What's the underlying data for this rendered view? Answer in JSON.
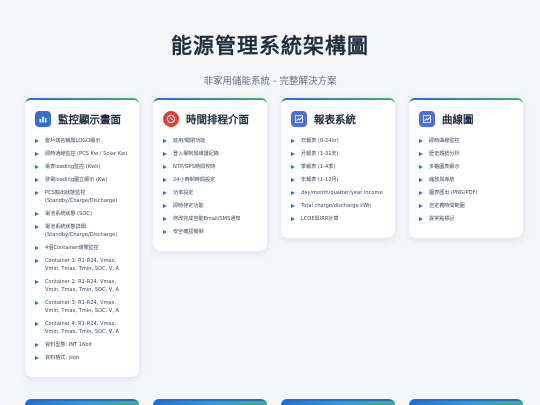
{
  "header": {
    "title": "能源管理系統架構圖",
    "subtitle": "非家用儲能系統 - 完整解決方案"
  },
  "cards": [
    {
      "icon": "monitor-chart-icon",
      "title": "監控顯示畫面",
      "items": [
        "客戶端名稱與LOGO顯示",
        "即時通線監控 (PCS Kw / Solar Kw)",
        "電表loading監控 (Kwh)",
        "發電loading圖立顯示 (Kw)",
        "PCS輸出狀態監控 (Standby/Charge/Discharge)",
        "電池系統狀態 (SOC)",
        "電池系統狀態詳細 (Standby/Charge/Discharge)",
        "4個Container總覽監控",
        "Container 1: R1-R24, Vmax, Vmin, Tmax, Tmin, SOC, V, A",
        "Container 2: R1-R24, Vmax, Vmin, Tmax, Tmin, SOC, V, A",
        "Container 3: R1-R24, Vmax, Vmin, Tmax, Tmin, SOC, V, A",
        "Container 4: R1-R24, Vmax, Vmin, Tmax, Tmin, SOC, V, A",
        "資料型態: INT 16bit",
        "資料格式: json"
      ]
    },
    {
      "icon": "clock-icon",
      "title": "時間排程介面",
      "items": [
        "啟用/關閉功能",
        "登入權制與維護紀錄",
        "NTP/GPS時間校時",
        "24小時制時間設定",
        "功率設定",
        "即時排定功能",
        "修改完成自動Email/SMS通知",
        "安全確認機制"
      ]
    },
    {
      "icon": "report-icon",
      "title": "報表系統",
      "items": [
        "日報表 (0-24hr)",
        "月報表 (1-31天)",
        "季報表 (1-4季)",
        "年報表 (1-12月)",
        "day/month/quarter/year income",
        "Total charge/discharge kWh",
        "LCOE與IRR計算"
      ]
    },
    {
      "icon": "line-chart-icon",
      "title": "曲線圖",
      "items": [
        "即時曲線監控",
        "歷史趨勢分析",
        "多軸圖表顯示",
        "縮放與導航",
        "圖表匯出 (PNG/PDF)",
        "自定義時間範圍",
        "異常點標記"
      ]
    }
  ],
  "colors": {
    "accent": "#2e6fd0",
    "accent_green": "#3bb273"
  }
}
